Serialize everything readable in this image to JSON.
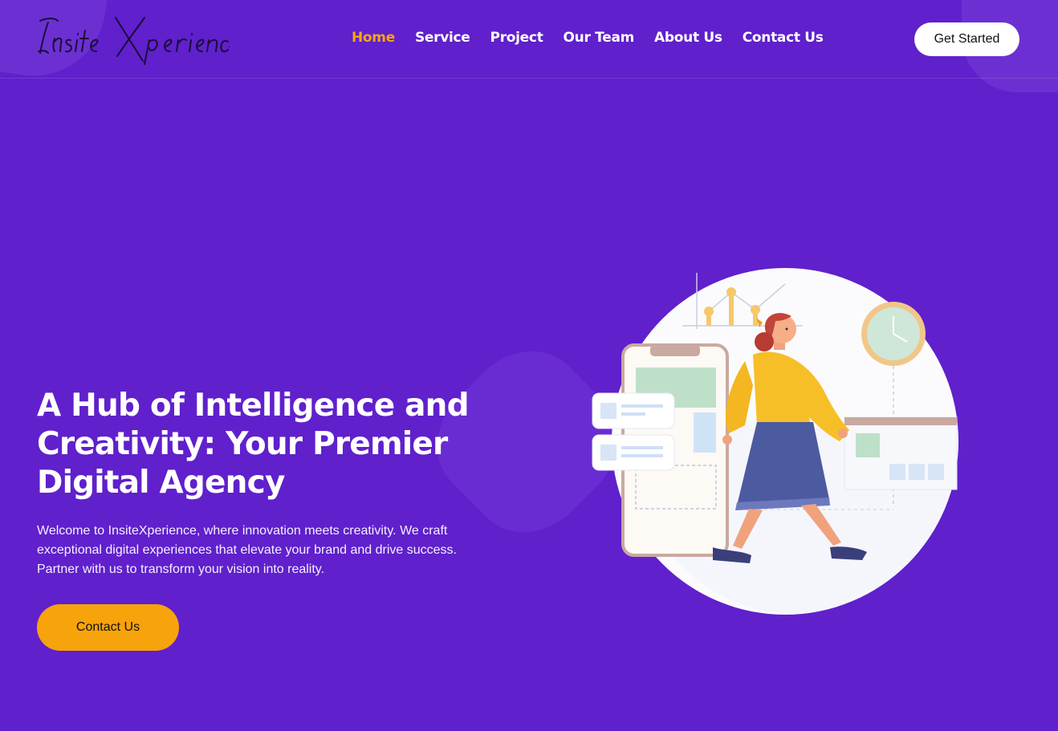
{
  "brand": {
    "logo_text": "InsiteXperience"
  },
  "nav": {
    "items": [
      {
        "label": "Home",
        "active": true
      },
      {
        "label": "Service",
        "active": false
      },
      {
        "label": "Project",
        "active": false
      },
      {
        "label": "Our Team",
        "active": false
      },
      {
        "label": "About Us",
        "active": false
      },
      {
        "label": "Contact Us",
        "active": false
      }
    ],
    "cta_label": "Get Started"
  },
  "hero": {
    "title": "A Hub of Intelligence and Creativity: Your Premier Digital Agency",
    "description": "Welcome to InsiteXperience, where innovation meets creativity. We craft exceptional digital experiences that elevate your brand and drive success. Partner with us to transform your vision into reality.",
    "button_label": "Contact Us"
  },
  "colors": {
    "background": "#6020cc",
    "accent": "#f7a30b",
    "nav_active": "#f5a512",
    "text": "#ffffff"
  },
  "icons": {
    "illustration": "woman-walking-with-phone-and-charts-illustration"
  }
}
